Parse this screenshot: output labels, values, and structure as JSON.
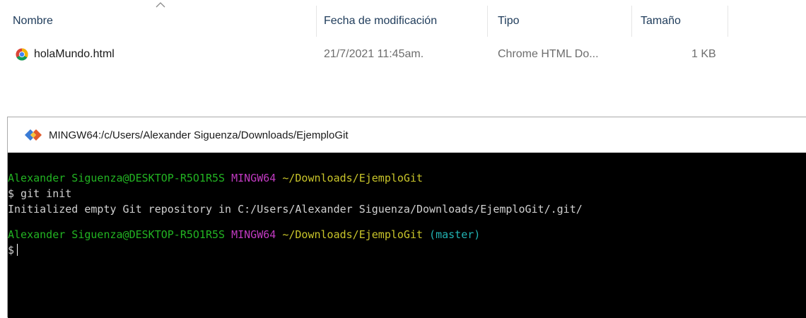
{
  "explorer": {
    "columns": {
      "name": "Nombre",
      "modified": "Fecha de modificación",
      "type": "Tipo",
      "size": "Tamaño"
    },
    "files": [
      {
        "icon": "chrome-icon",
        "name": "holaMundo.html",
        "modified": "21/7/2021 11:45am.",
        "type": "Chrome HTML Do...",
        "size": "1 KB"
      }
    ]
  },
  "terminal": {
    "title": "MINGW64:/c/Users/Alexander Siguenza/Downloads/EjemploGit",
    "prompt1": {
      "user_host": "Alexander Siguenza@DESKTOP-R5O1R5S",
      "shell": "MINGW64",
      "path": "~/Downloads/EjemploGit"
    },
    "command": "$ git init",
    "output": "Initialized empty Git repository in C:/Users/Alexander Siguenza/Downloads/EjemploGit/.git/",
    "prompt2": {
      "user_host": "Alexander Siguenza@DESKTOP-R5O1R5S",
      "shell": "MINGW64",
      "path": "~/Downloads/EjemploGit",
      "branch": "(master)"
    },
    "input_prompt": "$"
  },
  "colors": {
    "terminal_bg": "#000000",
    "user_host": "#22b422",
    "shell": "#c13ac1",
    "path": "#c9c52a",
    "branch": "#22b4b4"
  }
}
